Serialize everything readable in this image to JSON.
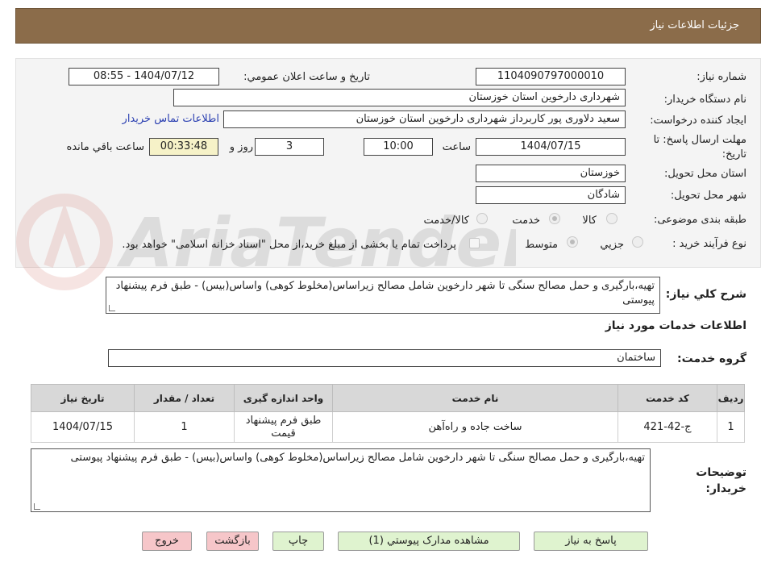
{
  "header": {
    "title": "جزئیات اطلاعات نیاز"
  },
  "form": {
    "need_number_label": "شماره نیاز:",
    "need_number": "1104090797000010",
    "announce_label": "تاریخ و ساعت اعلان عمومي:",
    "announce_value": "1404/07/12 - 08:55",
    "buyer_org_label": "نام دستگاه خريدار:",
    "buyer_org": "شهرداری دارخوین استان خوزستان",
    "requester_label": "ايجاد کننده درخواست:",
    "requester": "سعید دلاوری پور کاربرداز شهرداری دارخوین استان خوزستان",
    "contact_link": "اطلاعات تماس خريدار",
    "deadline_label": "مهلت ارسال پاسخ: تا تاريخ:",
    "deadline_date": "1404/07/15",
    "time_label": "ساعت",
    "deadline_time": "10:00",
    "days_value": "3",
    "days_label": "روز و",
    "remaining_time": "00:33:48",
    "remaining_label": "ساعت باقي مانده",
    "province_label": "استان محل تحويل:",
    "province": "خوزستان",
    "city_label": "شهر محل تحويل:",
    "city": "شادگان",
    "category_label": "طبقه بندی موضوعی:",
    "category_options": [
      "کالا",
      "خدمت",
      "کالا/خدمت"
    ],
    "category_selected": "خدمت",
    "process_label": "نوع فرآيند خريد :",
    "process_options": [
      "جزيي",
      "متوسط"
    ],
    "process_selected": "متوسط",
    "payment_note": "پرداخت تمام يا بخشی از مبلغ خريد،از محل \"اسناد خزانه اسلامی\" خواهد بود."
  },
  "general_description": {
    "label": "شرح کلي نياز:",
    "text": "تهیه،بارگیری و حمل مصالح سنگی تا شهر دارخوین شامل مصالح زیراساس(مخلوط کوهی) واساس(بیس) - طبق فرم پیشنهاد پیوستی"
  },
  "services": {
    "title": "اطلاعات خدمات مورد نياز",
    "group_label": "گروه خدمت:",
    "group_value": "ساختمان",
    "columns": [
      "رديف",
      "کد خدمت",
      "نام خدمت",
      "واحد اندازه گيری",
      "تعداد / مقدار",
      "تاریخ نیاز"
    ],
    "rows": [
      {
        "row": "1",
        "code": "ج-42-421",
        "name": "ساخت جاده و راه‌آهن",
        "unit": "طبق فرم پیشنهاد قیمت",
        "qty": "1",
        "date": "1404/07/15"
      }
    ]
  },
  "buyer_notes": {
    "label": "توضيحات خريدار:",
    "text": "تهیه،بارگیری و حمل مصالح سنگی تا شهر دارخوین شامل مصالح زیراساس(مخلوط کوهی) واساس(بیس) - طبق فرم پیشنهاد پیوستی"
  },
  "buttons": {
    "reply": "پاسخ به نياز",
    "attachments": "مشاهده مدارک پيوستي (1)",
    "print": "چاپ",
    "back": "بازگشت",
    "exit": "خروج"
  },
  "watermark_text": "AriaTender.neT",
  "colors": {
    "header": "#8b6c4a",
    "timer_bg": "#f6f2c8",
    "primary_btn": "#dff3cf",
    "danger_btn": "#f6c6c9",
    "link": "#2a3fb1"
  }
}
